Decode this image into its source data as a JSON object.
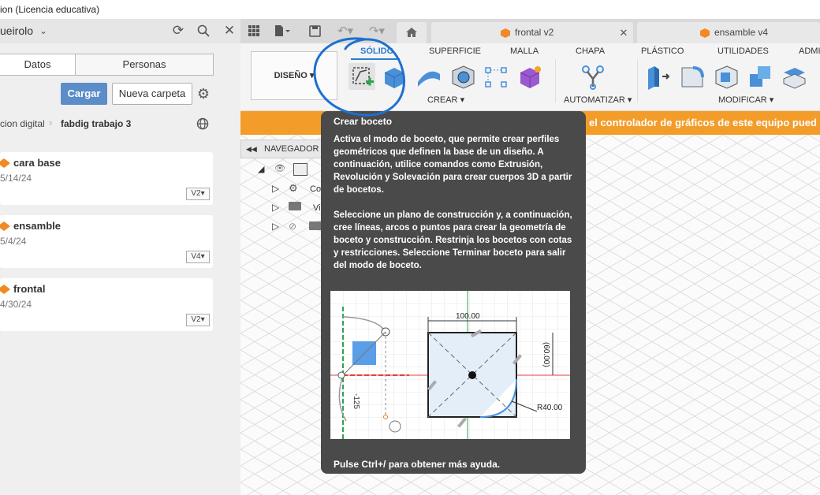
{
  "window": {
    "title": "ion (Licencia educativa)"
  },
  "left_header": {
    "project": "ueirolo"
  },
  "doc_tabs": [
    {
      "label": "frontal v2"
    },
    {
      "label": "ensamble v4"
    }
  ],
  "panel": {
    "tabs": [
      {
        "label": "Datos"
      },
      {
        "label": "Personas"
      }
    ],
    "upload_label": "Cargar",
    "new_folder_label": "Nueva carpeta",
    "breadcrumb": {
      "parent": "cion digital",
      "current": "fabdig trabajo 3"
    },
    "files": [
      {
        "name": "cara base",
        "date": "5/14/24",
        "version": "V2"
      },
      {
        "name": "ensamble",
        "date": "5/4/24",
        "version": "V4"
      },
      {
        "name": "frontal",
        "date": "4/30/24",
        "version": "V2"
      }
    ]
  },
  "toolbar": {
    "workspace": "DISEÑO",
    "tabs": [
      "SÓLIDO",
      "SUPERFICIE",
      "MALLA",
      "CHAPA",
      "PLÁSTICO",
      "UTILIDADES",
      "ADMI"
    ],
    "groups": {
      "create": "CREAR",
      "automate": "AUTOMATIZAR",
      "modify": "MODIFICAR"
    }
  },
  "banner": {
    "text": "el controlador de gráficos de este equipo pued"
  },
  "navigator": {
    "label": "NAVEGADOR",
    "items": [
      "Co",
      "Vi"
    ]
  },
  "tooltip": {
    "title": "Crear boceto",
    "p1": "Activa el modo de boceto, que permite crear perfiles geométricos que definen la base de un diseño. A continuación, utilice comandos como Extrusión, Revolución y Solevación para crear cuerpos 3D a partir de bocetos.",
    "p2": "Seleccione un plano de construcción y, a continuación, cree líneas, arcos o puntos para crear la geometría de boceto y construcción. Restrinja los bocetos con cotas y restricciones. Seleccione Terminar boceto para salir del modo de boceto.",
    "help": "Pulse Ctrl+/ para obtener más ayuda.",
    "illustration": {
      "dim_width": "100.00",
      "dim_height": "(60.00)",
      "dim_radius": "R40.00",
      "dim_angle": "-125"
    }
  },
  "colors": {
    "accent": "#2a7bd1",
    "banner": "#f39c2a",
    "upload": "#5b8ec8",
    "annotation": "#1e6fd0"
  }
}
